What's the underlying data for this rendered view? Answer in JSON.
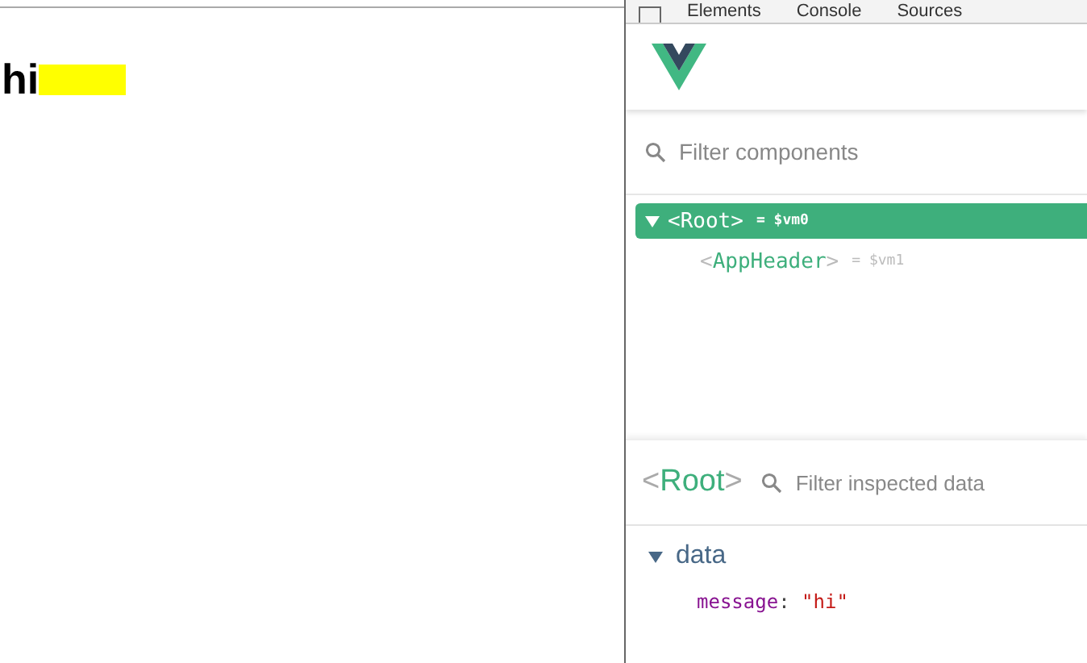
{
  "page": {
    "heading": "hi"
  },
  "devtools_tabs": [
    {
      "label": "Elements",
      "selected": false
    },
    {
      "label": "Console",
      "selected": false
    },
    {
      "label": "Sources",
      "selected": false
    }
  ],
  "filter_components": {
    "placeholder": "Filter components"
  },
  "component_tree": [
    {
      "open": "<",
      "name": "Root",
      "close": ">",
      "ref": "= $vm0",
      "selected": true,
      "expanded": true,
      "children": [
        {
          "open": "<",
          "name": "AppHeader",
          "close": ">",
          "ref": "= $vm1",
          "selected": false
        }
      ]
    }
  ],
  "inspector": {
    "component": {
      "open": "<",
      "name": "Root",
      "close": ">"
    },
    "filter": {
      "placeholder": "Filter inspected data"
    },
    "sections": [
      {
        "label": "data",
        "expanded": true,
        "properties": [
          {
            "key": "message",
            "separator": ":",
            "value": "\"hi\""
          }
        ]
      }
    ]
  }
}
